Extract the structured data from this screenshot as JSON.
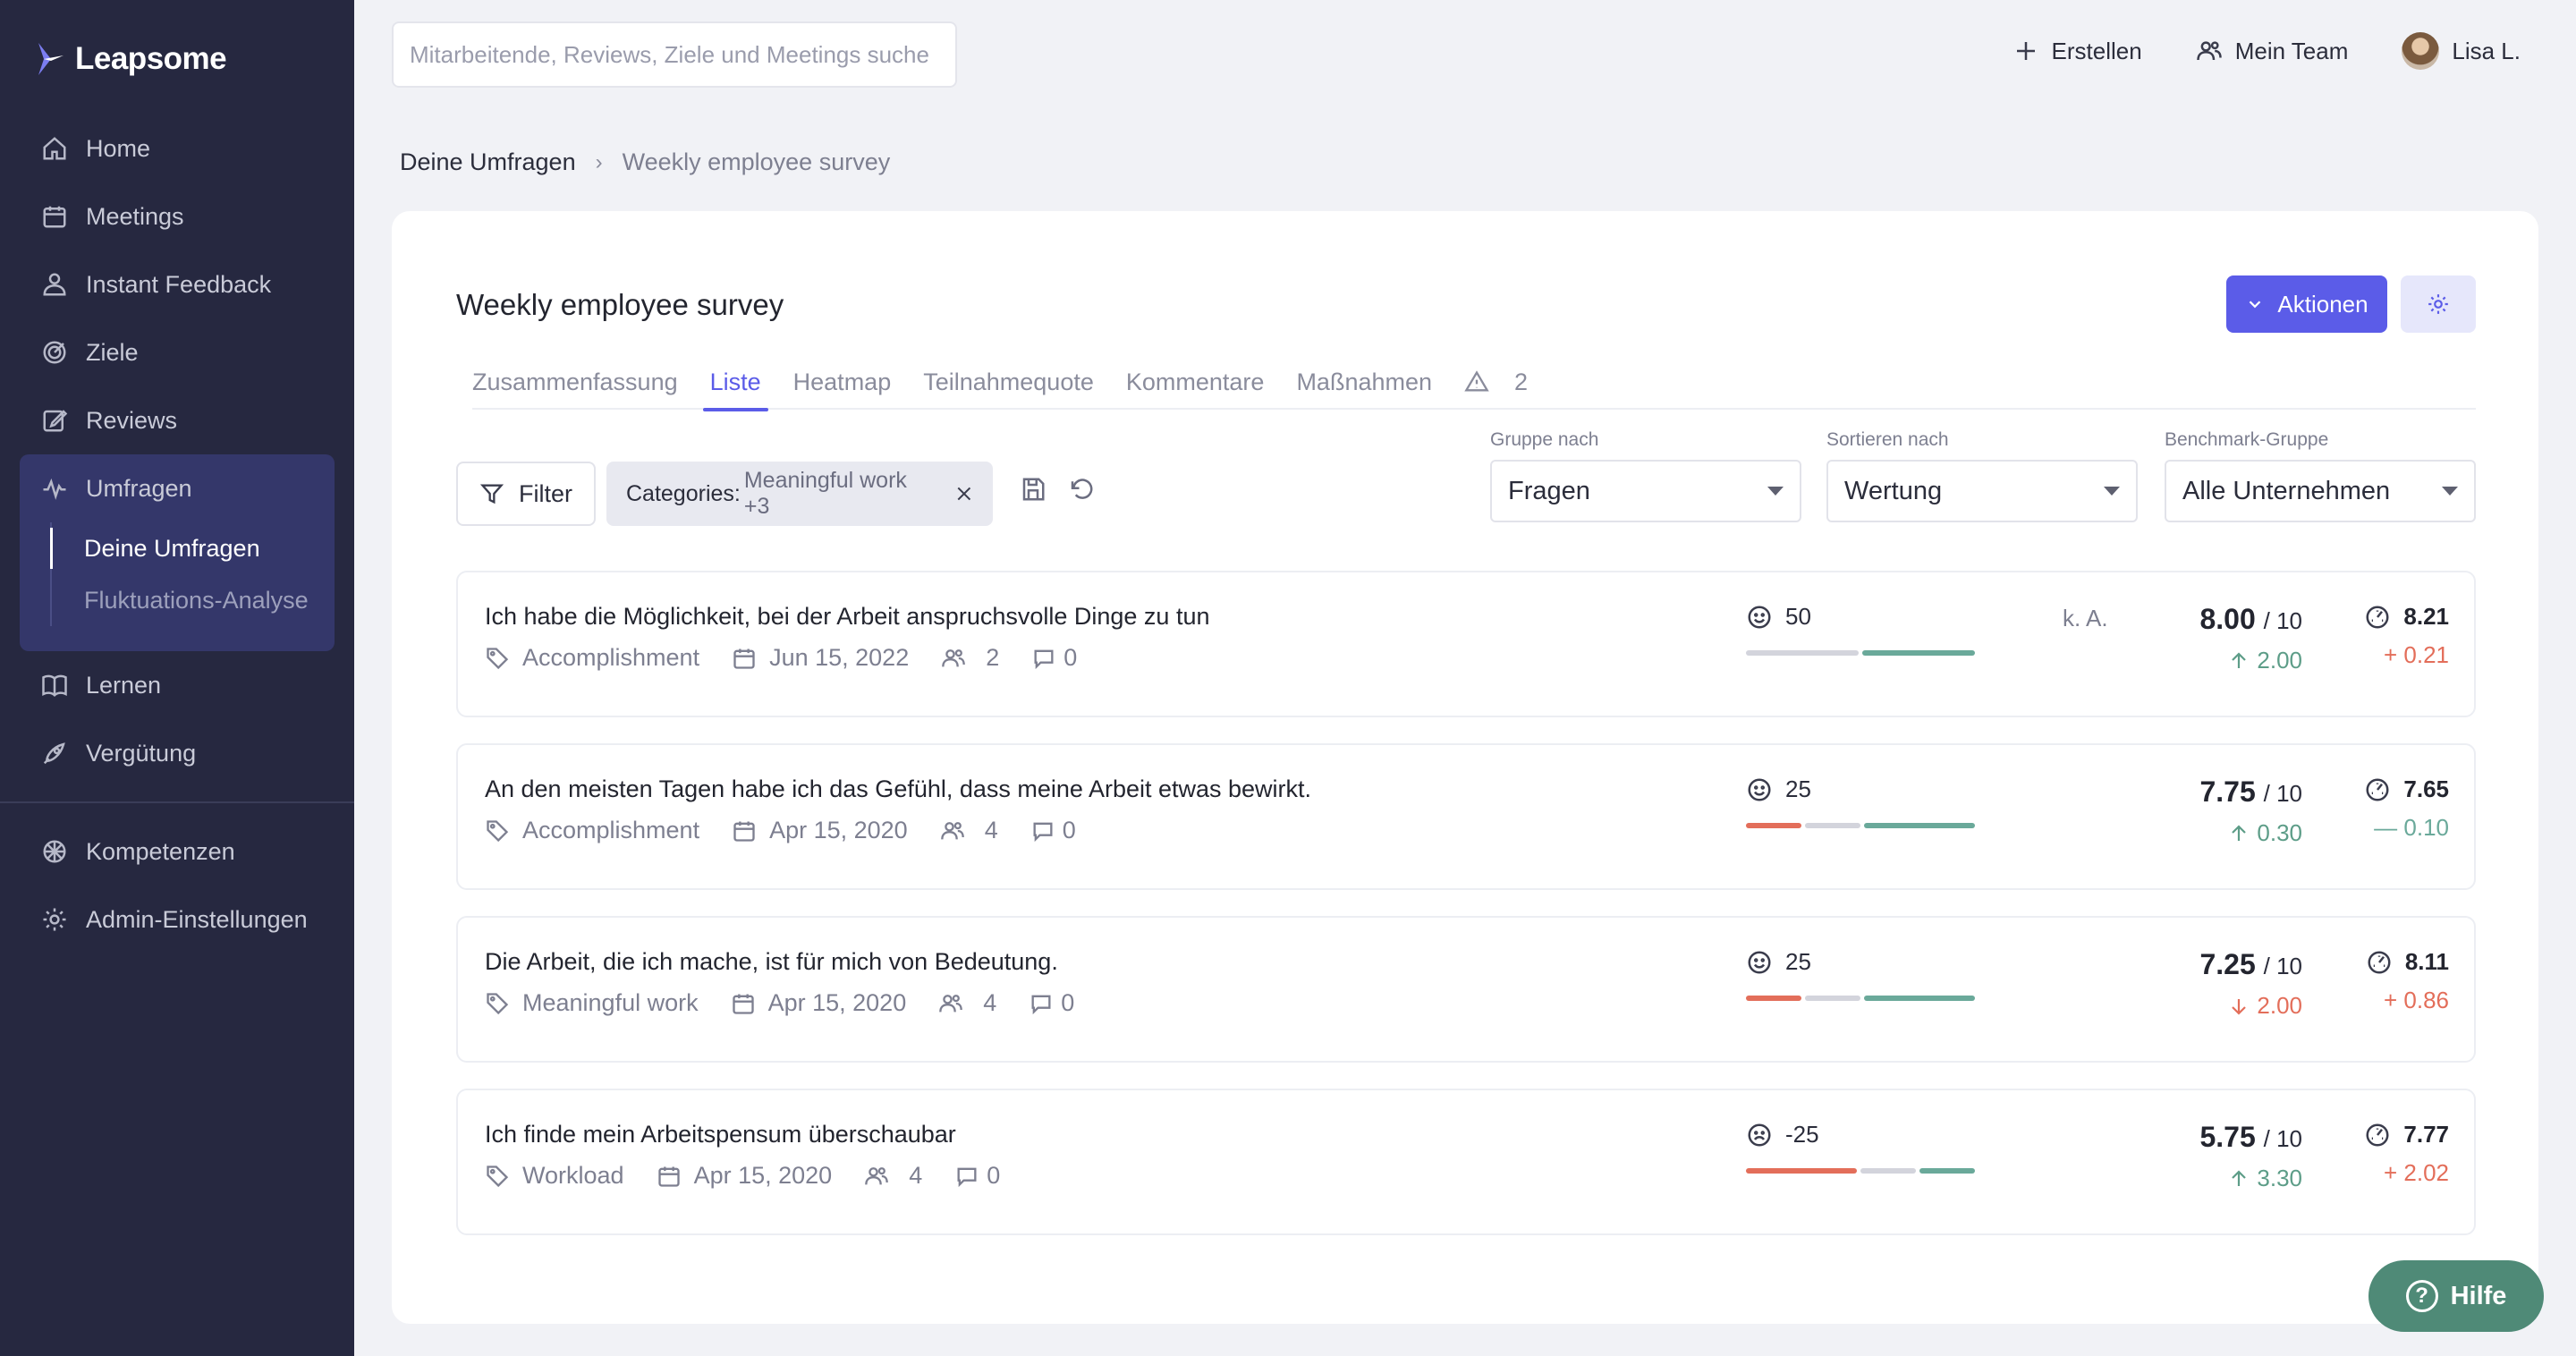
{
  "app": {
    "brand": "Leapsome",
    "colors": {
      "sidebar": "#262840",
      "accent": "#5b5ce8",
      "positive": "#6aa99a",
      "negative": "#e36e5a",
      "help": "#4f8a77"
    }
  },
  "sidebar": {
    "items": [
      {
        "label": "Home",
        "icon": "home-icon"
      },
      {
        "label": "Meetings",
        "icon": "calendar-icon"
      },
      {
        "label": "Instant Feedback",
        "icon": "feedback-icon"
      },
      {
        "label": "Ziele",
        "icon": "target-icon"
      },
      {
        "label": "Reviews",
        "icon": "edit-icon"
      }
    ],
    "group": {
      "label": "Umfragen",
      "icon": "pulse-icon",
      "sub_items": [
        {
          "label": "Deine Umfragen",
          "active": true
        },
        {
          "label": "Fluktuations-Analyse",
          "active": false
        }
      ]
    },
    "items_after": [
      {
        "label": "Lernen",
        "icon": "book-icon"
      },
      {
        "label": "Vergütung",
        "icon": "rocket-icon"
      }
    ],
    "items_bottom": [
      {
        "label": "Kompetenzen",
        "icon": "network-icon"
      },
      {
        "label": "Admin-Einstellungen",
        "icon": "gear-icon"
      }
    ]
  },
  "topbar": {
    "search_placeholder": "Mitarbeitende, Reviews, Ziele und Meetings suche",
    "create_label": "Erstellen",
    "team_label": "Mein Team",
    "user_name": "Lisa L."
  },
  "breadcrumb": {
    "parent": "Deine Umfragen",
    "separator": "›",
    "current": "Weekly employee survey"
  },
  "survey": {
    "title": "Weekly employee survey",
    "actions_label": "Aktionen",
    "tabs": [
      "Zusammenfassung",
      "Liste",
      "Heatmap",
      "Teilnahmequote",
      "Kommentare",
      "Maßnahmen"
    ],
    "active_tab": 1,
    "warnings_count": "2"
  },
  "filters": {
    "filter_label": "Filter",
    "chip_label": "Categories:",
    "chip_value": "Meaningful work +3",
    "group_by": {
      "label": "Gruppe nach",
      "value": "Fragen"
    },
    "sort_by": {
      "label": "Sortieren nach",
      "value": "Wertung"
    },
    "benchmark": {
      "label": "Benchmark-Gruppe",
      "value": "Alle Unternehmen"
    }
  },
  "questions": [
    {
      "text": "Ich habe die Möglichkeit, bei der Arbeit anspruchsvolle Dinge zu tun",
      "category": "Accomplishment",
      "date": "Jun 15, 2022",
      "respondents": "2",
      "comments": "0",
      "sentiment_icon": "smile-icon",
      "sentiment_score": "50",
      "distribution": {
        "negative": 0,
        "neutral": 0.5,
        "positive": 0.5
      },
      "na_label": "k. A.",
      "score": "8.00",
      "score_out_of": "/ 10",
      "score_delta": "2.00",
      "score_delta_dir": "up",
      "benchmark": "8.21",
      "benchmark_delta": "+ 0.21",
      "benchmark_delta_dir": "down"
    },
    {
      "text": "An den meisten Tagen habe ich das Gefühl, dass meine Arbeit etwas bewirkt.",
      "category": "Accomplishment",
      "date": "Apr 15, 2020",
      "respondents": "4",
      "comments": "0",
      "sentiment_icon": "smile-icon",
      "sentiment_score": "25",
      "distribution": {
        "negative": 0.25,
        "neutral": 0.25,
        "positive": 0.5
      },
      "na_label": "",
      "score": "7.75",
      "score_out_of": "/ 10",
      "score_delta": "0.30",
      "score_delta_dir": "up",
      "benchmark": "7.65",
      "benchmark_delta": "— 0.10",
      "benchmark_delta_dir": "neutral"
    },
    {
      "text": "Die Arbeit, die ich mache, ist für mich von Bedeutung.",
      "category": "Meaningful work",
      "date": "Apr 15, 2020",
      "respondents": "4",
      "comments": "0",
      "sentiment_icon": "smile-icon",
      "sentiment_score": "25",
      "distribution": {
        "negative": 0.25,
        "neutral": 0.25,
        "positive": 0.5
      },
      "na_label": "",
      "score": "7.25",
      "score_out_of": "/ 10",
      "score_delta": "2.00",
      "score_delta_dir": "down",
      "benchmark": "8.11",
      "benchmark_delta": "+ 0.86",
      "benchmark_delta_dir": "down"
    },
    {
      "text": "Ich finde mein Arbeitspensum überschaubar",
      "category": "Workload",
      "date": "Apr 15, 2020",
      "respondents": "4",
      "comments": "0",
      "sentiment_icon": "frown-icon",
      "sentiment_score": "-25",
      "distribution": {
        "negative": 0.5,
        "neutral": 0.25,
        "positive": 0.25
      },
      "na_label": "",
      "score": "5.75",
      "score_out_of": "/ 10",
      "score_delta": "3.30",
      "score_delta_dir": "up",
      "benchmark": "7.77",
      "benchmark_delta": "+ 2.02",
      "benchmark_delta_dir": "down"
    }
  ],
  "help": {
    "label": "Hilfe",
    "icon_glyph": "?"
  }
}
